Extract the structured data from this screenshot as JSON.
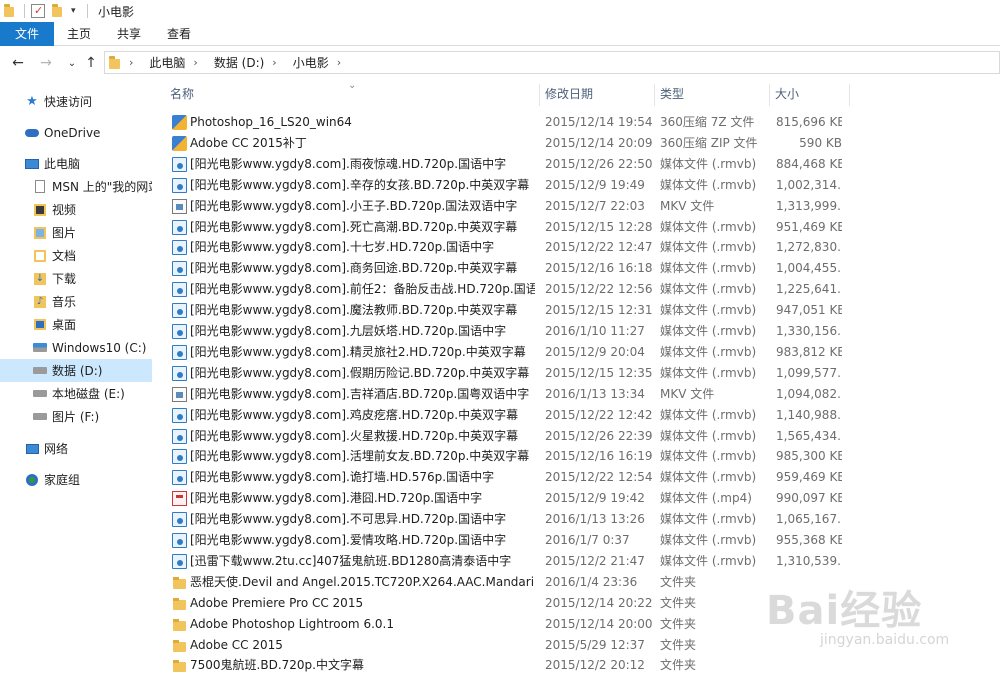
{
  "window": {
    "title": "小电影"
  },
  "ribbon": {
    "tabs": [
      "文件",
      "主页",
      "共享",
      "查看"
    ]
  },
  "address": {
    "crumbs": [
      "此电脑",
      "数据 (D:)",
      "小电影"
    ]
  },
  "sidebar": {
    "items": [
      {
        "label": "快速访问",
        "icon": "star-icon"
      },
      {
        "label": "OneDrive",
        "icon": "cloud-icon"
      },
      {
        "label": "此电脑",
        "icon": "computer-icon"
      },
      {
        "label": "MSN 上的\"我的网站",
        "icon": "document-icon"
      },
      {
        "label": "视频",
        "icon": "video-folder-icon"
      },
      {
        "label": "图片",
        "icon": "pictures-folder-icon"
      },
      {
        "label": "文档",
        "icon": "documents-folder-icon"
      },
      {
        "label": "下载",
        "icon": "downloads-folder-icon"
      },
      {
        "label": "音乐",
        "icon": "music-folder-icon"
      },
      {
        "label": "桌面",
        "icon": "desktop-folder-icon"
      },
      {
        "label": "Windows10 (C:)",
        "icon": "windows-drive-icon"
      },
      {
        "label": "数据 (D:)",
        "icon": "drive-icon",
        "selected": true
      },
      {
        "label": "本地磁盘 (E:)",
        "icon": "drive-icon"
      },
      {
        "label": "图片 (F:)",
        "icon": "drive-icon"
      },
      {
        "label": "网络",
        "icon": "network-icon"
      },
      {
        "label": "家庭组",
        "icon": "homegroup-icon"
      }
    ]
  },
  "columns": {
    "name": "名称",
    "date": "修改日期",
    "type": "类型",
    "size": "大小"
  },
  "files": [
    {
      "icon": "zip",
      "name": "Photoshop_16_LS20_win64",
      "date": "2015/12/14 19:54",
      "type": "360压缩 7Z 文件",
      "size": "815,696 KB"
    },
    {
      "icon": "zip",
      "name": "Adobe CC 2015补丁",
      "date": "2015/12/14 20:09",
      "type": "360压缩 ZIP 文件",
      "size": "590 KB"
    },
    {
      "icon": "media",
      "name": "[阳光电影www.ygdy8.com].雨夜惊魂.HD.720p.国语中字",
      "date": "2015/12/26 22:50",
      "type": "媒体文件 (.rmvb)",
      "size": "884,468 KB"
    },
    {
      "icon": "media",
      "name": "[阳光电影www.ygdy8.com].辛存的女孩.BD.720p.中英双字幕",
      "date": "2015/12/9 19:49",
      "type": "媒体文件 (.rmvb)",
      "size": "1,002,314..."
    },
    {
      "icon": "mkv",
      "name": "[阳光电影www.ygdy8.com].小王子.BD.720p.国法双语中字",
      "date": "2015/12/7 22:03",
      "type": "MKV 文件",
      "size": "1,313,999..."
    },
    {
      "icon": "media",
      "name": "[阳光电影www.ygdy8.com].死亡高潮.BD.720p.中英双字幕",
      "date": "2015/12/15 12:28",
      "type": "媒体文件 (.rmvb)",
      "size": "951,469 KB"
    },
    {
      "icon": "media",
      "name": "[阳光电影www.ygdy8.com].十七岁.HD.720p.国语中字",
      "date": "2015/12/22 12:47",
      "type": "媒体文件 (.rmvb)",
      "size": "1,272,830..."
    },
    {
      "icon": "media",
      "name": "[阳光电影www.ygdy8.com].商务回途.BD.720p.中英双字幕",
      "date": "2015/12/16 16:18",
      "type": "媒体文件 (.rmvb)",
      "size": "1,004,455..."
    },
    {
      "icon": "media",
      "name": "[阳光电影www.ygdy8.com].前任2：备胎反击战.HD.720p.国语...",
      "date": "2015/12/22 12:56",
      "type": "媒体文件 (.rmvb)",
      "size": "1,225,641..."
    },
    {
      "icon": "media",
      "name": "[阳光电影www.ygdy8.com].魔法教师.BD.720p.中英双字幕",
      "date": "2015/12/15 12:31",
      "type": "媒体文件 (.rmvb)",
      "size": "947,051 KB"
    },
    {
      "icon": "media",
      "name": "[阳光电影www.ygdy8.com].九层妖塔.HD.720p.国语中字",
      "date": "2016/1/10 11:27",
      "type": "媒体文件 (.rmvb)",
      "size": "1,330,156..."
    },
    {
      "icon": "media",
      "name": "[阳光电影www.ygdy8.com].精灵旅社2.HD.720p.中英双字幕",
      "date": "2015/12/9 20:04",
      "type": "媒体文件 (.rmvb)",
      "size": "983,812 KB"
    },
    {
      "icon": "media",
      "name": "[阳光电影www.ygdy8.com].假期历险记.BD.720p.中英双字幕",
      "date": "2015/12/15 12:35",
      "type": "媒体文件 (.rmvb)",
      "size": "1,099,577..."
    },
    {
      "icon": "mkv",
      "name": "[阳光电影www.ygdy8.com].吉祥酒店.BD.720p.国粤双语中字",
      "date": "2016/1/13 13:34",
      "type": "MKV 文件",
      "size": "1,094,082..."
    },
    {
      "icon": "media",
      "name": "[阳光电影www.ygdy8.com].鸡皮疙瘩.HD.720p.中英双字幕",
      "date": "2015/12/22 12:42",
      "type": "媒体文件 (.rmvb)",
      "size": "1,140,988..."
    },
    {
      "icon": "media",
      "name": "[阳光电影www.ygdy8.com].火星救援.HD.720p.中英双字幕",
      "date": "2015/12/26 22:39",
      "type": "媒体文件 (.rmvb)",
      "size": "1,565,434..."
    },
    {
      "icon": "media",
      "name": "[阳光电影www.ygdy8.com].活埋前女友.BD.720p.中英双字幕",
      "date": "2015/12/16 16:19",
      "type": "媒体文件 (.rmvb)",
      "size": "985,300 KB"
    },
    {
      "icon": "media",
      "name": "[阳光电影www.ygdy8.com].诡打墙.HD.576p.国语中字",
      "date": "2015/12/22 12:54",
      "type": "媒体文件 (.rmvb)",
      "size": "959,469 KB"
    },
    {
      "icon": "mp4",
      "name": "[阳光电影www.ygdy8.com].港囧.HD.720p.国语中字",
      "date": "2015/12/9 19:42",
      "type": "媒体文件 (.mp4)",
      "size": "990,097 KB"
    },
    {
      "icon": "media",
      "name": "[阳光电影www.ygdy8.com].不可思异.HD.720p.国语中字",
      "date": "2016/1/13 13:26",
      "type": "媒体文件 (.rmvb)",
      "size": "1,065,167..."
    },
    {
      "icon": "media",
      "name": "[阳光电影www.ygdy8.com].爱情攻略.HD.720p.国语中字",
      "date": "2016/1/7 0:37",
      "type": "媒体文件 (.rmvb)",
      "size": "955,368 KB"
    },
    {
      "icon": "media",
      "name": "[迅雷下载www.2tu.cc]407猛鬼航班.BD1280高清泰语中字",
      "date": "2015/12/2 21:47",
      "type": "媒体文件 (.rmvb)",
      "size": "1,310,539..."
    },
    {
      "icon": "folder",
      "name": "恶棍天使.Devil and Angel.2015.TC720P.X264.AAC.Mandarin...",
      "date": "2016/1/4 23:36",
      "type": "文件夹",
      "size": ""
    },
    {
      "icon": "folder",
      "name": "Adobe Premiere Pro CC 2015",
      "date": "2015/12/14 20:22",
      "type": "文件夹",
      "size": ""
    },
    {
      "icon": "folder",
      "name": "Adobe Photoshop Lightroom 6.0.1",
      "date": "2015/12/14 20:00",
      "type": "文件夹",
      "size": ""
    },
    {
      "icon": "folder",
      "name": "Adobe CC 2015",
      "date": "2015/5/29 12:37",
      "type": "文件夹",
      "size": ""
    },
    {
      "icon": "folder",
      "name": "7500鬼航班.BD.720p.中文字幕",
      "date": "2015/12/2 20:12",
      "type": "文件夹",
      "size": ""
    }
  ],
  "watermark": {
    "main": "Bai经验",
    "sub": "jingyan.baidu.com"
  }
}
